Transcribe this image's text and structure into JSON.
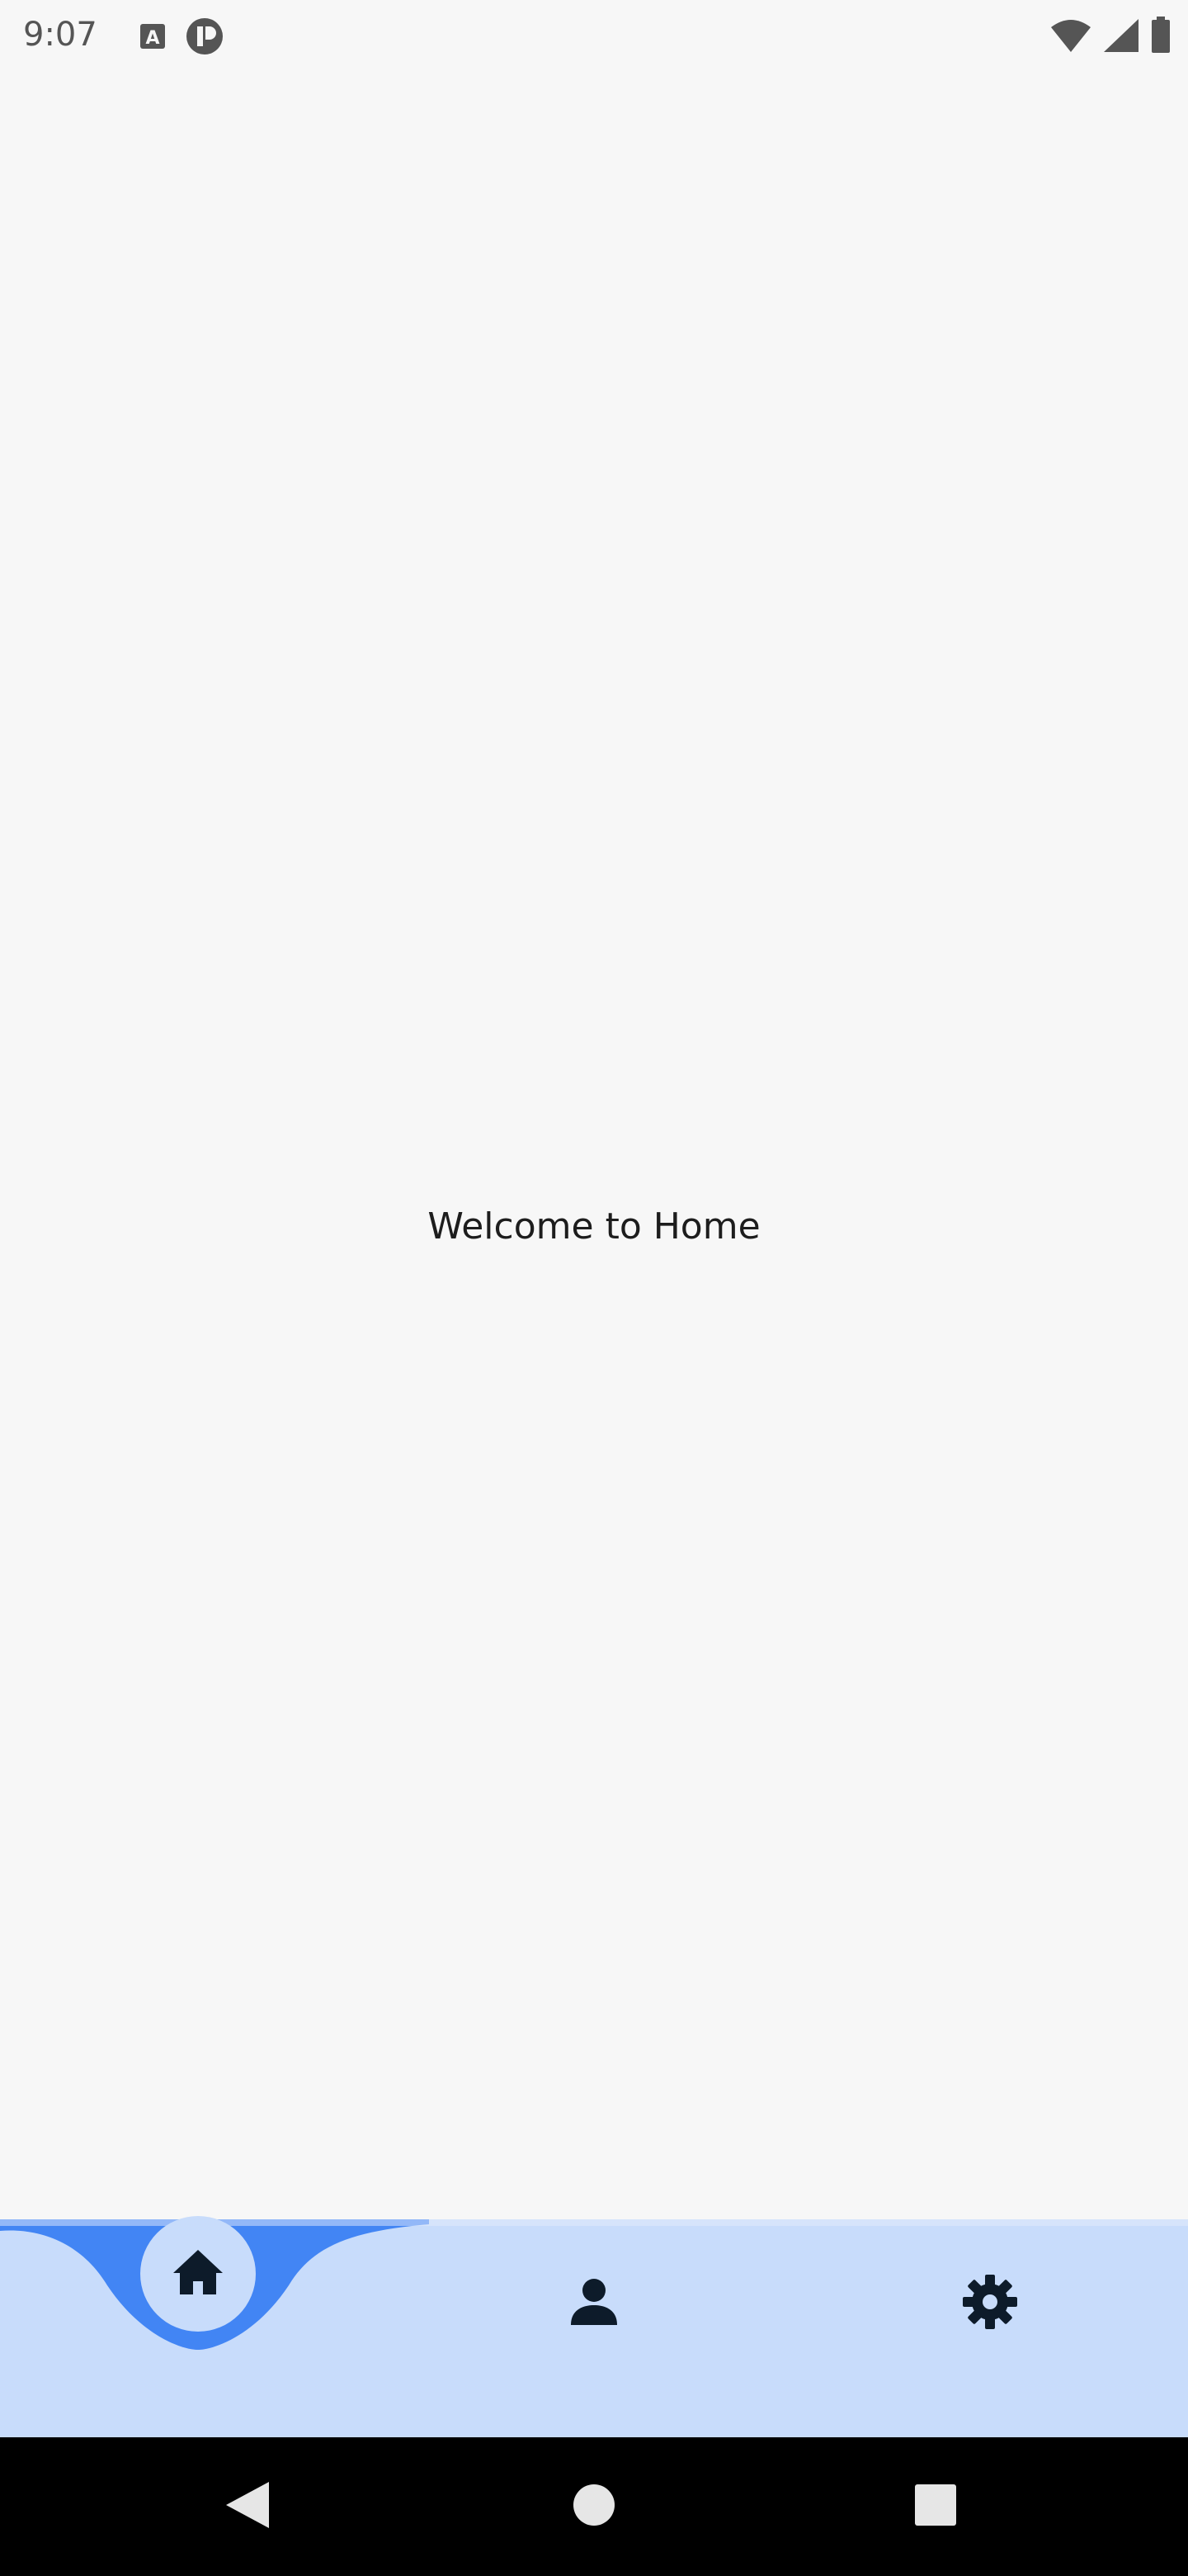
{
  "status_bar": {
    "time": "9:07",
    "left_icons": [
      "text-a-icon",
      "app-notification-icon"
    ],
    "right_icons": [
      "wifi-icon",
      "cell-signal-icon",
      "battery-icon"
    ]
  },
  "main": {
    "welcome_text": "Welcome to Home"
  },
  "bottom_nav": {
    "items": [
      {
        "name": "home",
        "icon": "home-icon",
        "selected": true
      },
      {
        "name": "profile",
        "icon": "person-icon",
        "selected": false
      },
      {
        "name": "settings",
        "icon": "gear-icon",
        "selected": false
      }
    ],
    "colors": {
      "bar": "#c8dcfb",
      "accent": "#4285f4",
      "icon": "#0d1b2a"
    }
  },
  "system_nav": {
    "buttons": [
      "back-icon",
      "home-circle-icon",
      "recents-icon"
    ]
  }
}
